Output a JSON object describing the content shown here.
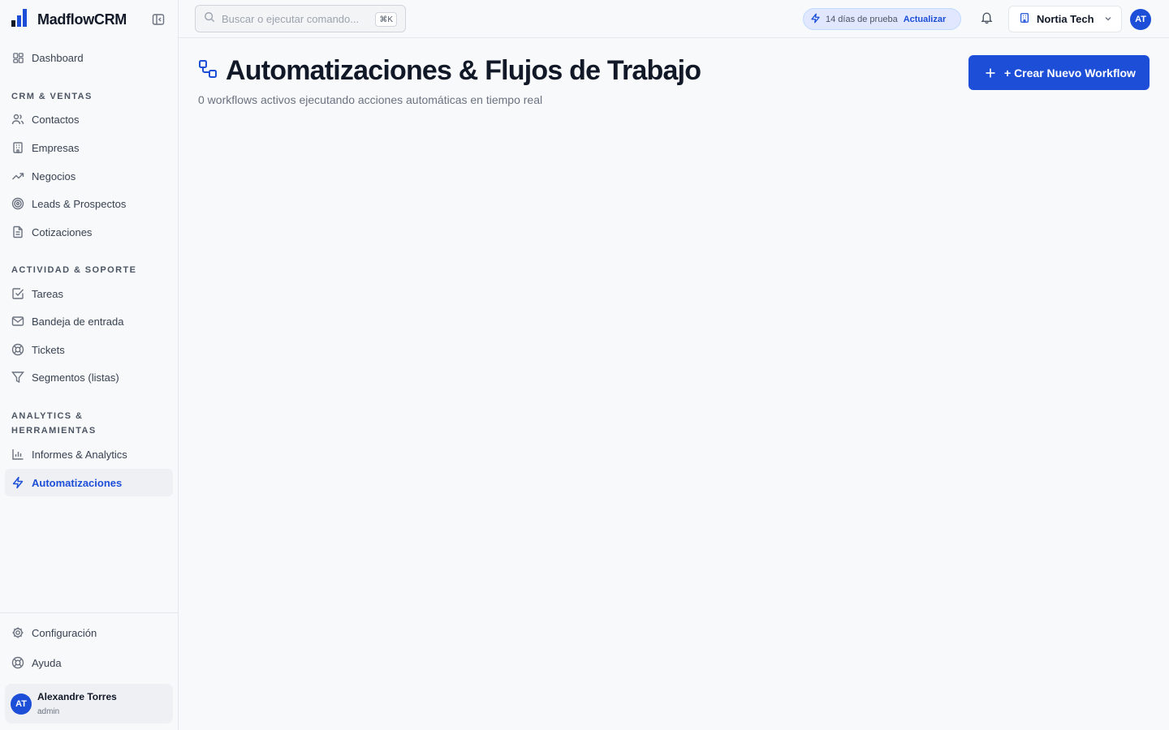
{
  "brand": {
    "name": "MadflowCRM",
    "logo_icon": "bar-chart-logo-icon",
    "accent": "#1d4ed8"
  },
  "sidebar": {
    "dashboard": {
      "label": "Dashboard",
      "icon": "grid-icon"
    },
    "sections": [
      {
        "title": "CRM & VENTAS",
        "items": [
          {
            "label": "Contactos",
            "icon": "users-icon"
          },
          {
            "label": "Empresas",
            "icon": "building-icon"
          },
          {
            "label": "Negocios",
            "icon": "trending-up-icon"
          },
          {
            "label": "Leads & Prospectos",
            "icon": "target-icon"
          },
          {
            "label": "Cotizaciones",
            "icon": "file-text-icon"
          }
        ]
      },
      {
        "title": "ACTIVIDAD & SOPORTE",
        "items": [
          {
            "label": "Tareas",
            "icon": "check-square-icon"
          },
          {
            "label": "Bandeja de entrada",
            "icon": "mail-icon"
          },
          {
            "label": "Tickets",
            "icon": "life-buoy-icon"
          },
          {
            "label": "Segmentos (listas)",
            "icon": "filter-icon"
          }
        ]
      },
      {
        "title": "ANALYTICS & HERRAMIENTAS",
        "items": [
          {
            "label": "Informes & Analytics",
            "icon": "bar-chart-icon"
          },
          {
            "label": "Automatizaciones",
            "icon": "zap-icon",
            "active": true
          }
        ]
      }
    ],
    "footer": [
      {
        "label": "Configuración",
        "icon": "settings-icon"
      },
      {
        "label": "Ayuda",
        "icon": "help-circle-icon"
      }
    ],
    "user": {
      "initials": "AT",
      "name": "Alexandre Torres",
      "role": "admin"
    }
  },
  "topbar": {
    "search": {
      "placeholder": "Buscar o ejecutar comando...",
      "shortcut": "⌘K"
    },
    "trial": {
      "text": "14 días de prueba",
      "upgrade": "Actualizar"
    },
    "org": {
      "name": "Nortia Tech"
    },
    "avatar_initials": "AT"
  },
  "main": {
    "title": "Automatizaciones & Flujos de Trabajo",
    "subtitle": "0 workflows activos ejecutando acciones automáticas en tiempo real",
    "create_button": "+ Crear Nuevo Workflow"
  }
}
